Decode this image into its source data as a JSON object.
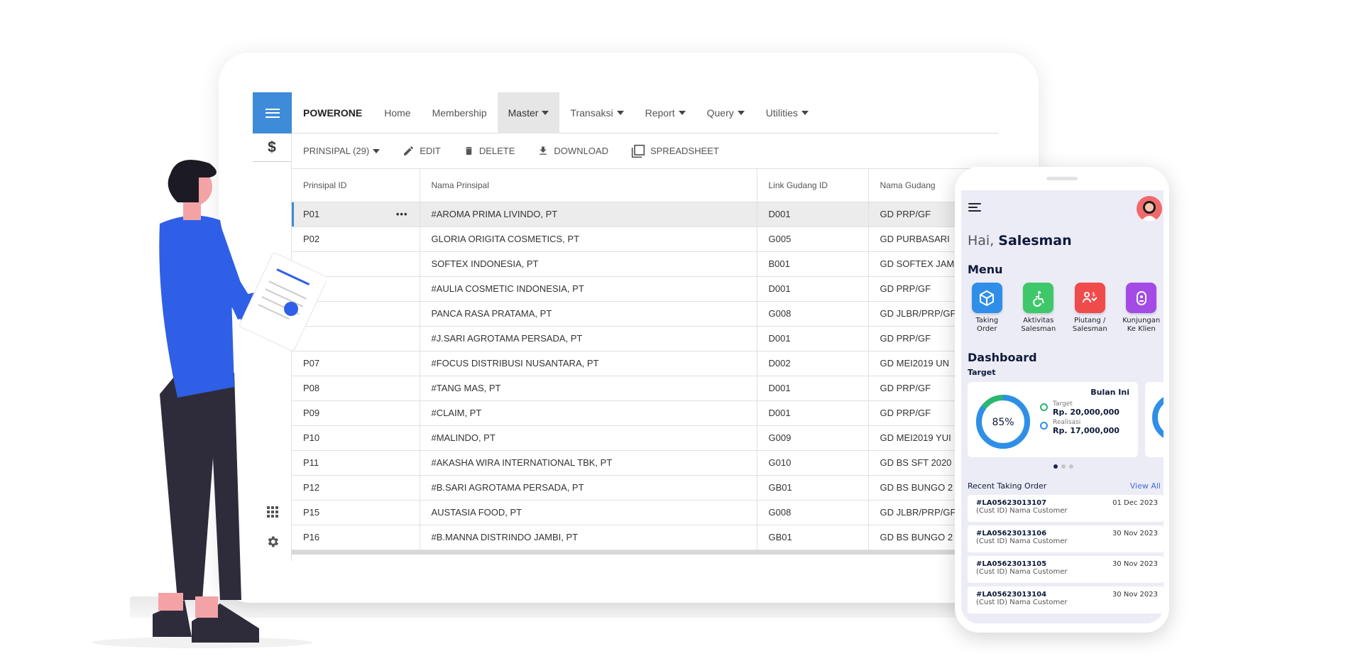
{
  "app": {
    "brand": "POWERONE",
    "nav": [
      {
        "label": "Home",
        "dropdown": false,
        "active": false
      },
      {
        "label": "Membership",
        "dropdown": false,
        "active": false
      },
      {
        "label": "Master",
        "dropdown": true,
        "active": true
      },
      {
        "label": "Transaksi",
        "dropdown": true,
        "active": false
      },
      {
        "label": "Report",
        "dropdown": true,
        "active": false
      },
      {
        "label": "Query",
        "dropdown": true,
        "active": false
      },
      {
        "label": "Utilities",
        "dropdown": true,
        "active": false
      }
    ],
    "sidebar": {
      "top_icons": [
        "menu-icon",
        "dollar-icon"
      ],
      "dollar_symbol": "$",
      "bottom_icons": [
        "grid-icon",
        "gear-icon"
      ]
    },
    "toolbar": {
      "entity": "PRINSIPAL (29)",
      "edit": "EDIT",
      "delete": "DELETE",
      "download": "DOWNLOAD",
      "spreadsheet": "SPREADSHEET"
    },
    "table": {
      "columns": [
        "Prinsipal ID",
        "Nama Prinsipal",
        "Link Gudang ID",
        "Nama Gudang"
      ],
      "rows": [
        [
          "P01",
          "#AROMA PRIMA LIVINDO, PT",
          "D001",
          "GD PRP/GF"
        ],
        [
          "P02",
          "GLORIA ORIGITA COSMETICS, PT",
          "G005",
          "GD PURBASARI"
        ],
        [
          "",
          "SOFTEX INDONESIA, PT",
          "B001",
          "GD SOFTEX JAM"
        ],
        [
          "",
          "#AULIA COSMETIC INDONESIA, PT",
          "D001",
          "GD PRP/GF"
        ],
        [
          "",
          "PANCA RASA PRATAMA, PT",
          "G008",
          "GD JLBR/PRP/GF"
        ],
        [
          "",
          "#J.SARI AGROTAMA PERSADA, PT",
          "D001",
          "GD PRP/GF"
        ],
        [
          "P07",
          "#FOCUS DISTRIBUSI NUSANTARA, PT",
          "D002",
          "GD MEI2019 UN"
        ],
        [
          "P08",
          "#TANG MAS, PT",
          "D001",
          "GD PRP/GF"
        ],
        [
          "P09",
          "#CLAIM, PT",
          "D001",
          "GD PRP/GF"
        ],
        [
          "P10",
          "#MALINDO, PT",
          "G009",
          "GD MEI2019 YUI"
        ],
        [
          "P11",
          "#AKASHA WIRA INTERNATIONAL TBK, PT",
          "G010",
          "GD BS SFT 2020"
        ],
        [
          "P12",
          "#B.SARI AGROTAMA PERSADA, PT",
          "GB01",
          "GD BS BUNGO 2"
        ],
        [
          "P15",
          "AUSTASIA FOOD, PT",
          "G008",
          "GD JLBR/PRP/GF"
        ],
        [
          "P16",
          "#B.MANNA DISTRINDO JAMBI, PT",
          "GB01",
          "GD BS BUNGO 2"
        ]
      ],
      "selected_row": 0
    }
  },
  "phone": {
    "greeting_prefix": "Hai,",
    "greeting_name": "Salesman",
    "menu_title": "Menu",
    "menu_items": [
      {
        "line1": "Taking",
        "line2": "Order",
        "icon": "box-icon",
        "color": "#2f8fe8"
      },
      {
        "line1": "Aktivitas",
        "line2": "Salesman",
        "icon": "accessibility-icon",
        "color": "#3fc86a"
      },
      {
        "line1": "Piutang /",
        "line2": "Salesman",
        "icon": "receivable-icon",
        "color": "#f04b4b"
      },
      {
        "line1": "Kunjungan",
        "line2": "Ke Klien",
        "icon": "visit-icon",
        "color": "#a44be6"
      }
    ],
    "dashboard_title": "Dashboard",
    "target_label": "Target",
    "card": {
      "period": "Bulan Ini",
      "percent_label": "85%",
      "percent_value": 85,
      "target_label": "Target",
      "target_value": "Rp. 20,000,000",
      "realisasi_label": "Realisasi",
      "realisasi_value": "Rp. 17,000,000"
    },
    "recent_title": "Recent Taking Order",
    "view_all": "View All",
    "orders": [
      {
        "id": "#LA05623013107",
        "customer": "(Cust ID) Nama Customer",
        "date": "01 Dec 2023"
      },
      {
        "id": "#LA05623013106",
        "customer": "(Cust ID) Nama Customer",
        "date": "30 Nov 2023"
      },
      {
        "id": "#LA05623013105",
        "customer": "(Cust ID) Nama Customer",
        "date": "30 Nov 2023"
      },
      {
        "id": "#LA05623013104",
        "customer": "(Cust ID) Nama Customer",
        "date": "30 Nov 2023"
      }
    ]
  },
  "colors": {
    "accent": "#3d8bd9",
    "donut_progress": "#2f8fe8",
    "donut_secondary": "#2bb673"
  }
}
